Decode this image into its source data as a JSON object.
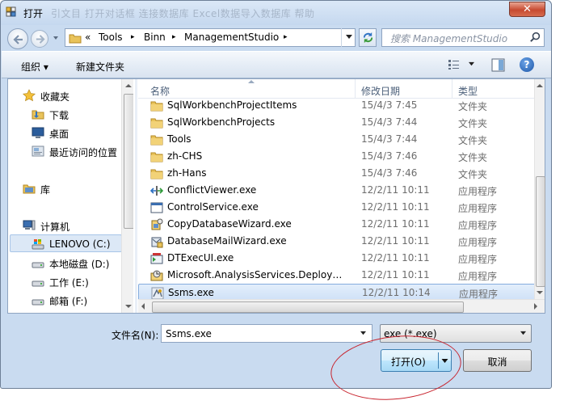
{
  "window": {
    "title": "打开",
    "background_menu_text": "引文目  打开对话框    连接数据库    Excel数据导入数据库      帮助",
    "close_glyph": "✕"
  },
  "address_bar": {
    "prefix": "«",
    "crumbs": [
      "Tools",
      "Binn",
      "ManagementStudio"
    ],
    "separator": "▸"
  },
  "search": {
    "placeholder": "搜索 ManagementStudio"
  },
  "toolbar": {
    "organize_label": "组织 ▾",
    "new_folder_label": "新建文件夹",
    "help_glyph": "?"
  },
  "nav_pane": {
    "favorites": {
      "label": "收藏夹",
      "items": [
        "下载",
        "桌面",
        "最近访问的位置"
      ]
    },
    "libraries": {
      "label": "库"
    },
    "computer": {
      "label": "计算机",
      "drives": [
        "LENOVO (C:)",
        "本地磁盘 (D:)",
        "工作 (E:)",
        "邮箱 (F:)"
      ]
    }
  },
  "file_list": {
    "columns": [
      "名称",
      "修改日期",
      "类型"
    ],
    "rows": [
      {
        "name": "SqlWorkbenchProjectItems",
        "date": "15/4/3 7:45",
        "type": "文件夹",
        "icon": "folder-icon"
      },
      {
        "name": "SqlWorkbenchProjects",
        "date": "15/4/3 7:44",
        "type": "文件夹",
        "icon": "folder-icon"
      },
      {
        "name": "Tools",
        "date": "15/4/3 7:44",
        "type": "文件夹",
        "icon": "folder-icon"
      },
      {
        "name": "zh-CHS",
        "date": "15/4/3 7:46",
        "type": "文件夹",
        "icon": "folder-icon"
      },
      {
        "name": "zh-Hans",
        "date": "15/4/3 7:46",
        "type": "文件夹",
        "icon": "folder-icon"
      },
      {
        "name": "ConflictViewer.exe",
        "date": "12/2/11 10:11",
        "type": "应用程序",
        "icon": "conflict-viewer-icon"
      },
      {
        "name": "ControlService.exe",
        "date": "12/2/11 10:11",
        "type": "应用程序",
        "icon": "window-app-icon"
      },
      {
        "name": "CopyDatabaseWizard.exe",
        "date": "12/2/11 10:11",
        "type": "应用程序",
        "icon": "wizard-icon"
      },
      {
        "name": "DatabaseMailWizard.exe",
        "date": "12/2/11 10:11",
        "type": "应用程序",
        "icon": "mail-wizard-icon"
      },
      {
        "name": "DTExecUI.exe",
        "date": "12/2/11 10:11",
        "type": "应用程序",
        "icon": "dtexec-icon"
      },
      {
        "name": "Microsoft.AnalysisServices.Deployme...",
        "date": "12/2/11 10:11",
        "type": "应用程序",
        "icon": "analysis-services-icon"
      },
      {
        "name": "Ssms.exe",
        "date": "12/2/11 10:14",
        "type": "应用程序",
        "icon": "ssms-icon"
      }
    ],
    "selected_index": 11
  },
  "file_name": {
    "label": "文件名(N):",
    "value": "Ssms.exe"
  },
  "file_type": {
    "value": "exe (*.exe)"
  },
  "buttons": {
    "open": "打开(O)",
    "cancel": "取消"
  },
  "colors": {
    "annotation_circle": "#c8242e",
    "selection": "#cde0f7"
  }
}
